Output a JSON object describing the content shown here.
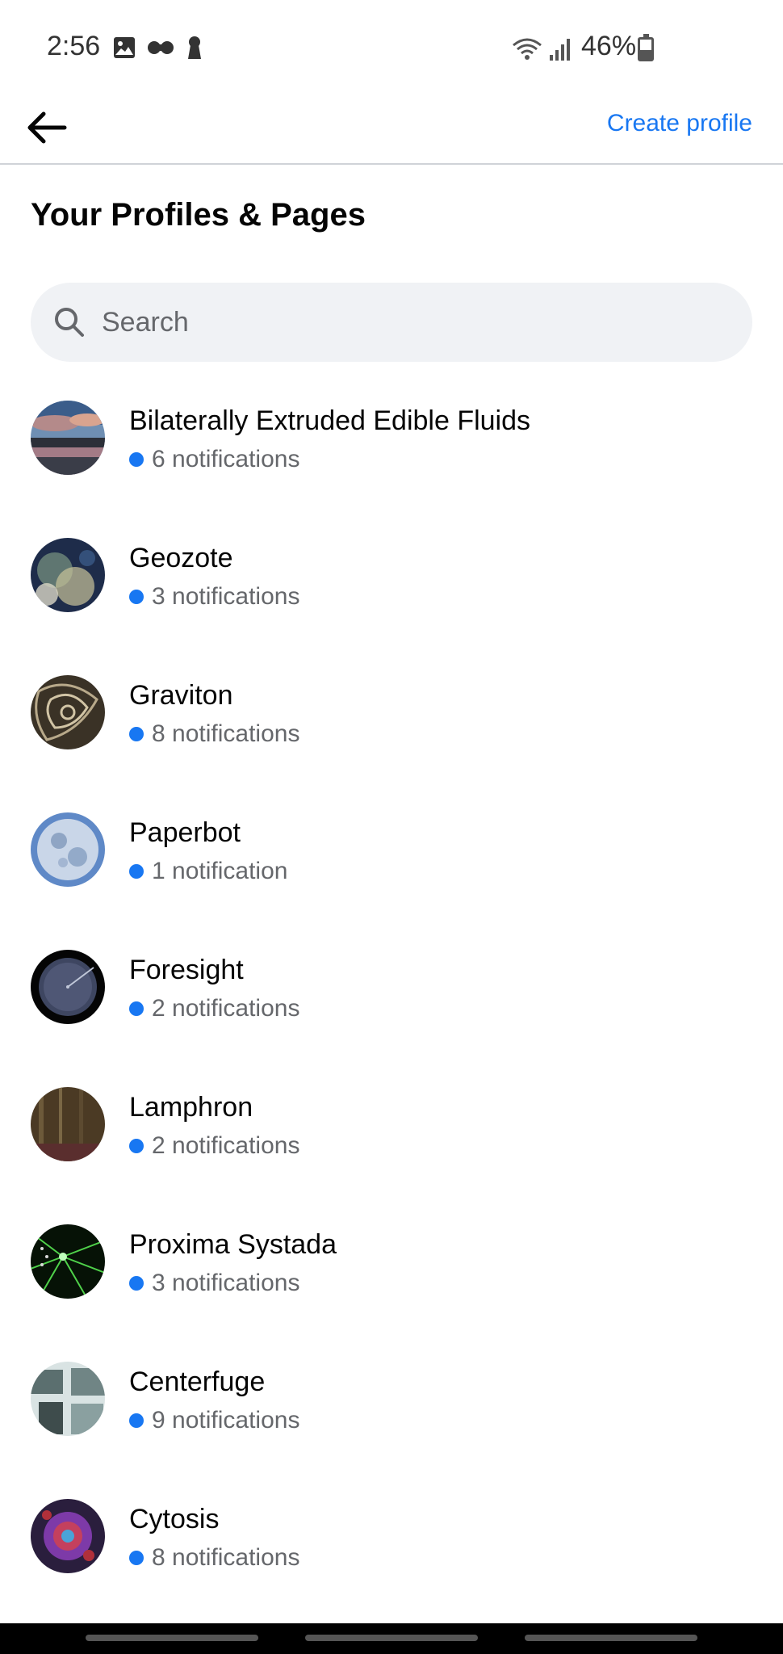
{
  "status_bar": {
    "time": "2:56",
    "battery": "46%",
    "icons_left": [
      "image-icon",
      "voicemail-icon",
      "keyhole-icon"
    ],
    "icons_right": [
      "wifi-icon",
      "signal-icon",
      "battery-icon"
    ]
  },
  "app_bar": {
    "back_icon": "back-arrow-icon",
    "create_profile": "Create profile"
  },
  "page": {
    "title": "Your Profiles & Pages"
  },
  "search": {
    "placeholder": "Search"
  },
  "profiles": [
    {
      "name": "Bilaterally Extruded Edible Fluids",
      "notifications": "6 notifications"
    },
    {
      "name": "Geozote",
      "notifications": "3 notifications"
    },
    {
      "name": "Graviton",
      "notifications": "8 notifications"
    },
    {
      "name": "Paperbot",
      "notifications": "1 notification"
    },
    {
      "name": "Foresight",
      "notifications": "2 notifications"
    },
    {
      "name": "Lamphron",
      "notifications": "2 notifications"
    },
    {
      "name": "Proxima Systada",
      "notifications": "3 notifications"
    },
    {
      "name": "Centerfuge",
      "notifications": "9 notifications"
    },
    {
      "name": "Cytosis",
      "notifications": "8 notifications"
    }
  ],
  "colors": {
    "accent": "#1877f2",
    "notification_dot": "#1877f2",
    "secondary_text": "#65676b",
    "search_bg": "#f0f2f5"
  }
}
